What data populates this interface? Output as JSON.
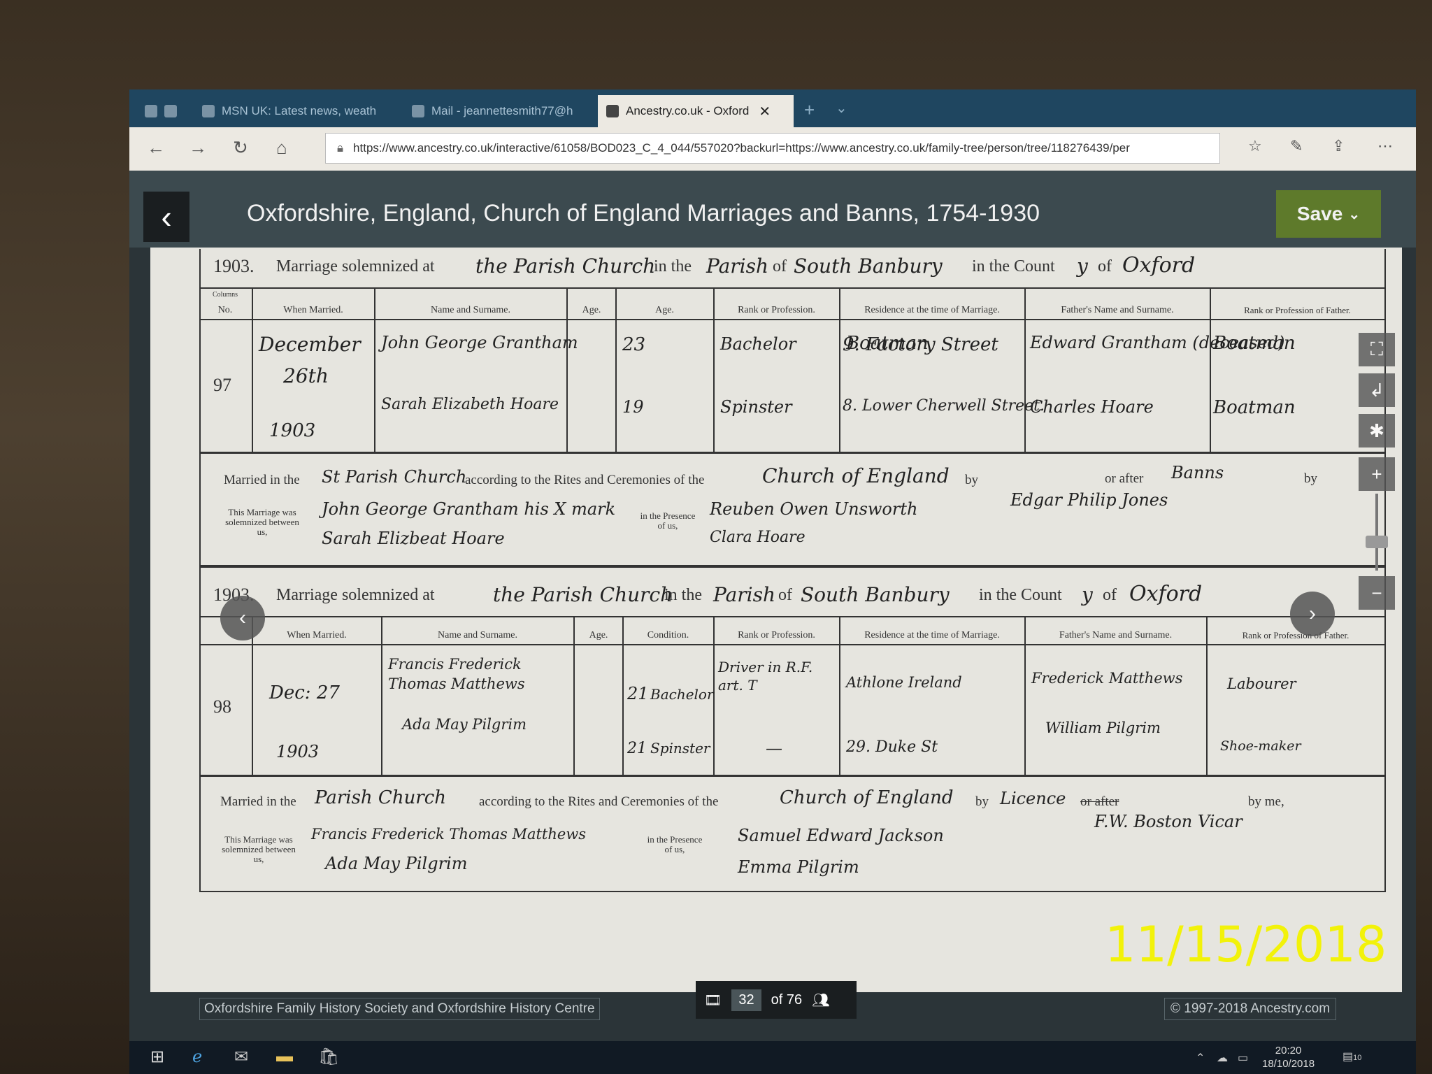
{
  "browser": {
    "tabs": [
      {
        "label": ""
      },
      {
        "label": "MSN UK: Latest news, weath"
      },
      {
        "label": "Mail - jeannettesmith77@h"
      },
      {
        "label": "Ancestry.co.uk - Oxford"
      }
    ],
    "url": "https://www.ancestry.co.uk/interactive/61058/BOD023_C_4_044/557020?backurl=https://www.ancestry.co.uk/family-tree/person/tree/118276439/per"
  },
  "header": {
    "title": "Oxfordshire, England, Church of England Marriages and Banns, 1754-1930",
    "save_label": "Save"
  },
  "register": {
    "headings": {
      "columns": "Columns",
      "no": "No.",
      "when_married": "When Married.",
      "name": "Name and Surname.",
      "age": "Age.",
      "condition": "Condition.",
      "rank": "Rank or Profession.",
      "residence": "Residence at the time of Marriage.",
      "father": "Father's Name and Surname.",
      "father_rank": "Rank or Profession of Father.",
      "married_in": "Married in the",
      "rites": "according to the Rites and Ceremonies of the",
      "by": "by",
      "or_after": "or after",
      "by_me": "by me,",
      "between": "This Marriage was solemnized between us,",
      "presence": "in the Presence of us,"
    },
    "entries": [
      {
        "year": "1903.",
        "intro": "Marriage solemnized at",
        "place": "the Parish Church",
        "in_the": "in the",
        "parish_word": "Parish",
        "of": "of",
        "parish": "South Banbury",
        "county_prefix": "in the Count",
        "county_y": "y",
        "county_of": "of",
        "county": "Oxford",
        "no": "97",
        "date": [
          "December",
          "26th",
          "1903"
        ],
        "groom": {
          "name": "John George Grantham",
          "age": "23",
          "condition": "Bachelor",
          "rank": "Boatman",
          "residence": "9. Factory Street",
          "father": "Edward Grantham (deceased)",
          "father_rank": "Boatman"
        },
        "bride": {
          "name": "Sarah Elizabeth Hoare",
          "age": "19",
          "condition": "Spinster",
          "rank": "",
          "residence": "8. Lower Cherwell Street.",
          "father": "Charles Hoare",
          "father_rank": "Boatman"
        },
        "church": "St Parish Church",
        "rite": "Church of England",
        "banns": "Banns",
        "officiant": "Edgar Philip Jones",
        "signatures": [
          "John George Grantham his X mark",
          "Sarah Elizbeat Hoare"
        ],
        "witnesses": [
          "Reuben Owen Unsworth",
          "Clara Hoare"
        ]
      },
      {
        "year": "1903.",
        "intro": "Marriage solemnized at",
        "place": "the Parish Church",
        "in_the": "in the",
        "parish_word": "Parish",
        "of": "of",
        "parish": "South Banbury",
        "county_prefix": "in the Count",
        "county_y": "y",
        "county_of": "of",
        "county": "Oxford",
        "no": "98",
        "date": [
          "Dec: 27",
          "",
          "1903"
        ],
        "groom": {
          "name": "Francis Frederick Thomas Matthews",
          "age": "21",
          "condition": "Bachelor",
          "rank": "Driver in R.F. art. T",
          "residence": "Athlone Ireland",
          "father": "Frederick Matthews",
          "father_rank": "Labourer"
        },
        "bride": {
          "name": "Ada May Pilgrim",
          "age": "21",
          "condition": "Spinster",
          "rank": "—",
          "residence": "29. Duke St",
          "father": "William Pilgrim",
          "father_rank": "Shoe-maker"
        },
        "church": "Parish Church",
        "rite": "Church of England",
        "banns": "Licence",
        "officiant": "F.W. Boston Vicar",
        "signatures": [
          "Francis Frederick Thomas Matthews",
          "Ada May Pilgrim"
        ],
        "witnesses": [
          "Samuel Edward Jackson",
          "Emma Pilgrim"
        ]
      }
    ]
  },
  "viewer": {
    "page_current": "32",
    "page_of": "of 76",
    "source": "Oxfordshire Family History Society and Oxfordshire History Centre",
    "copyright": "© 1997-2018 Ancestry.com"
  },
  "taskbar": {
    "time": "20:20",
    "date": "18/10/2018",
    "notif_count": "10"
  },
  "photo_datestamp": "11/15/2018",
  "colors": {
    "tabbar": "#1f4660",
    "header": "#3c4a4f",
    "save": "#5e7a2b",
    "stamp": "#f2f20a"
  }
}
